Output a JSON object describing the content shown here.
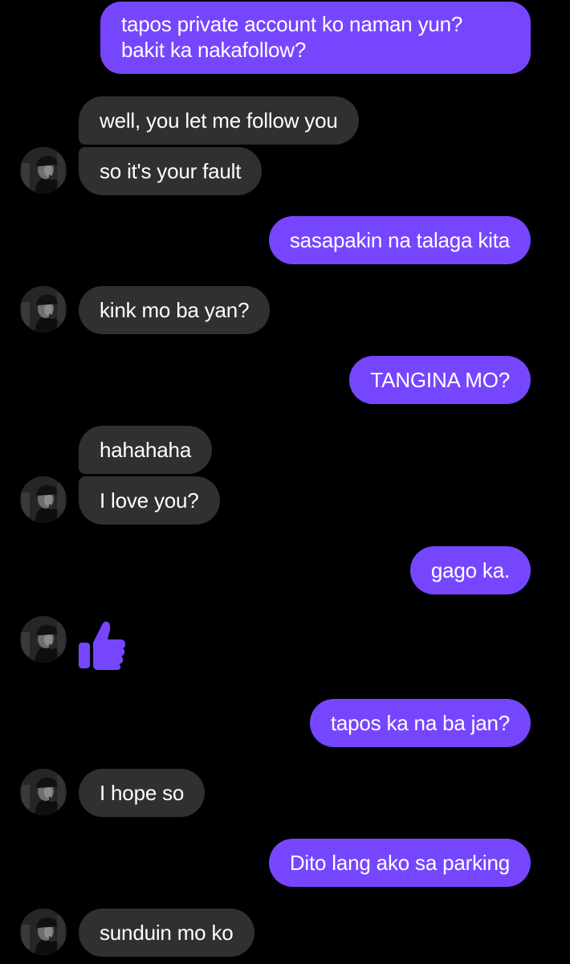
{
  "conversation": {
    "messages": [
      {
        "id": "m1",
        "sender": "me",
        "text": "tapos private account ko naman yun?\nbakit ka nakafollow?"
      },
      {
        "id": "m2",
        "sender": "them",
        "text": "well, you let me follow you"
      },
      {
        "id": "m3",
        "sender": "them",
        "text": "so it's your fault"
      },
      {
        "id": "m4",
        "sender": "me",
        "text": "sasapakin na talaga kita"
      },
      {
        "id": "m5",
        "sender": "them",
        "text": "kink mo ba yan?"
      },
      {
        "id": "m6",
        "sender": "me",
        "text": "TANGINA MO?"
      },
      {
        "id": "m7",
        "sender": "them",
        "text": "hahahaha"
      },
      {
        "id": "m8",
        "sender": "them",
        "text": "I love you?"
      },
      {
        "id": "m9",
        "sender": "me",
        "text": "gago ka."
      },
      {
        "id": "m10",
        "sender": "them",
        "reaction": "thumbs-up-icon"
      },
      {
        "id": "m11",
        "sender": "me",
        "text": "tapos ka na ba jan?"
      },
      {
        "id": "m12",
        "sender": "them",
        "text": "I hope so"
      },
      {
        "id": "m13",
        "sender": "me",
        "text": "Dito lang ako sa parking"
      },
      {
        "id": "m14",
        "sender": "them",
        "text": "sunduin mo ko"
      }
    ]
  },
  "colors": {
    "background": "#000000",
    "sent_bubble": "#7646ff",
    "received_bubble": "#303030",
    "text": "#ffffff",
    "reaction": "#7646ff"
  },
  "icons": {
    "avatar": "contact-avatar",
    "reaction": "thumbs-up-icon"
  }
}
